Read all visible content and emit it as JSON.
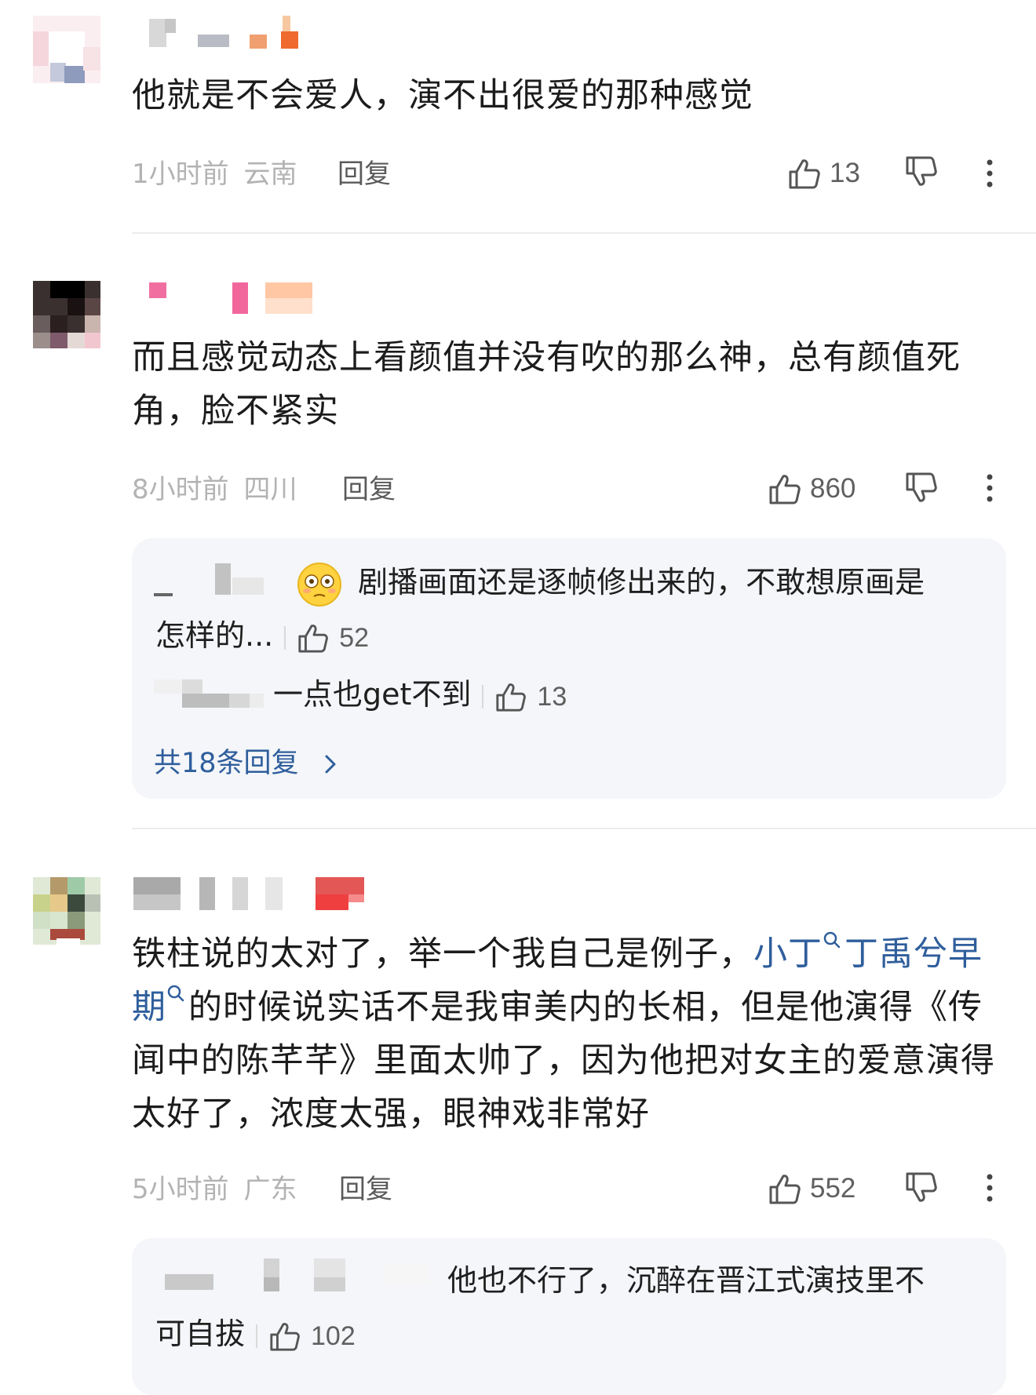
{
  "comments": [
    {
      "text": "他就是不会爱人，演不出很爱的那种感觉",
      "time": "1小时前",
      "location": "云南",
      "reply_label": "回复",
      "likes": "13"
    },
    {
      "text": "而且感觉动态上看颜值并没有吹的那么神，总有颜值死角，脸不紧实",
      "time": "8小时前",
      "location": "四川",
      "reply_label": "回复",
      "likes": "860",
      "replies": [
        {
          "text_line1": "剧播画面还是逐帧修出来的，不敢想原画是",
          "text_line2": "怎样的...",
          "emoji": "flushed-face-emoji",
          "likes": "52"
        },
        {
          "text": "一点也get不到",
          "likes": "13"
        }
      ],
      "more_replies": "共18条回复"
    },
    {
      "text_before_link": "铁柱说的太对了，举一个我自己是例子，",
      "link1": "小丁",
      "link2_line1": "丁禹兮早",
      "link2_line2": "期",
      "text_after_link": "的时候说实话不是我审美内的长相，但是他演得《传",
      "text_line3": "闻中的陈芊芊》里面太帅了，因为他把对女主的爱意演得",
      "text_line4": "太好了，浓度太强，眼神戏非常好",
      "time": "5小时前",
      "location": "广东",
      "reply_label": "回复",
      "likes": "552",
      "replies": [
        {
          "text_line1": "他也不行了，沉醉在晋江式演技里不",
          "text_line2": "可自拔",
          "likes": "102"
        }
      ]
    }
  ],
  "icons": {
    "like": "thumbs-up-icon",
    "dislike": "thumbs-down-icon",
    "more": "more-vertical-icon",
    "search": "search-icon",
    "chevron": "chevron-right-icon"
  },
  "colors": {
    "link": "#2f5e9c",
    "meta": "#b3b3b3",
    "thread_bg": "#f4f6f9"
  }
}
